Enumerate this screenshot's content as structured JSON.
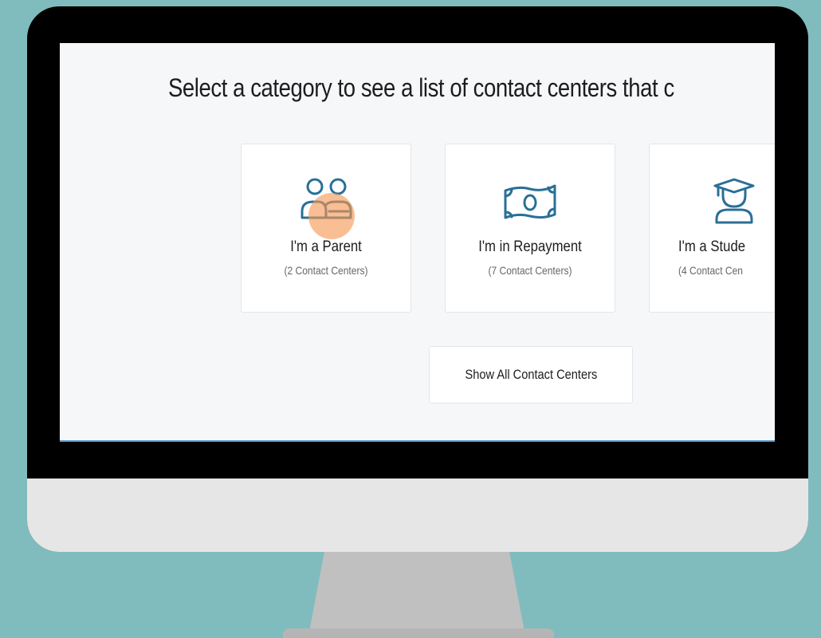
{
  "page": {
    "heading": "Select a category to see a list of contact centers that c"
  },
  "categories": [
    {
      "icon": "parents-icon",
      "label": "I'm a Parent",
      "count": "(2 Contact Centers)"
    },
    {
      "icon": "money-bill-icon",
      "label": "I'm in Repayment",
      "count": "(7 Contact Centers)"
    },
    {
      "icon": "student-graduate-icon",
      "label": "I'm a Stude",
      "count": "(4 Contact Cen"
    }
  ],
  "actions": {
    "show_all_label": "Show All Contact Centers"
  },
  "colors": {
    "background": "#80bcbd",
    "icon_accent": "#2a6f97",
    "cursor_highlight": "#f69650",
    "screen_bg": "#f6f7f9"
  }
}
